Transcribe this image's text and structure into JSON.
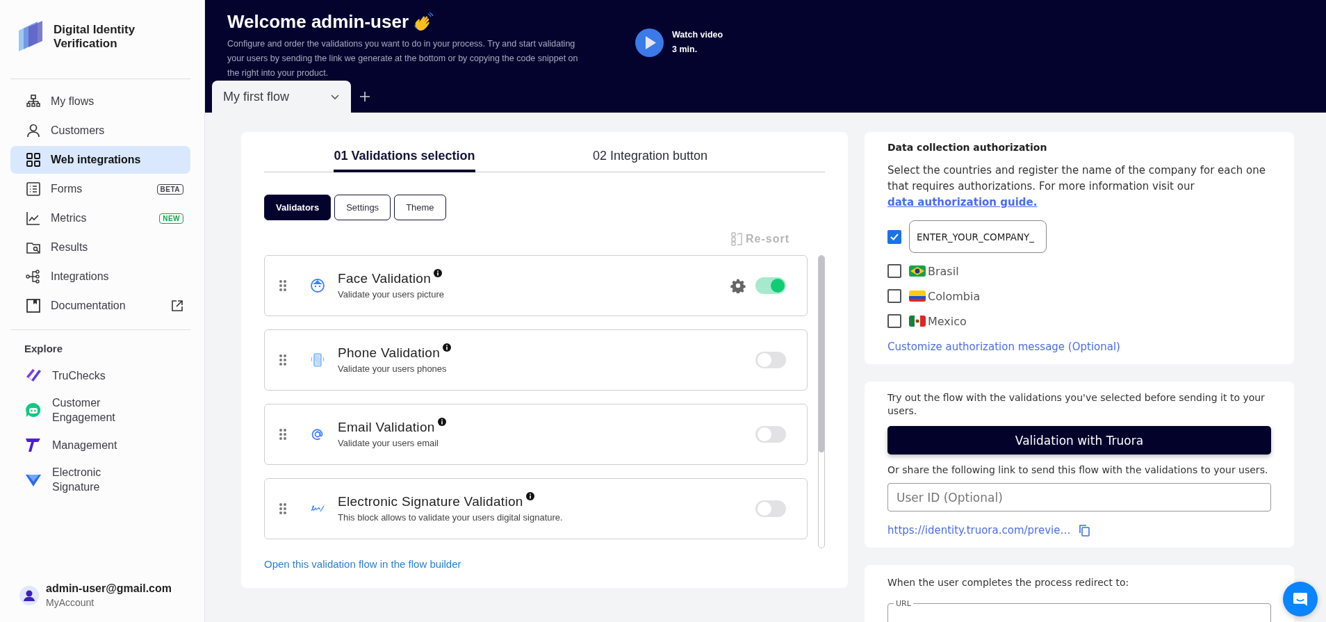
{
  "sidebar": {
    "product_title": "Digital Identity Verification",
    "nav_items": [
      {
        "label": "My flows",
        "selected": false
      },
      {
        "label": "Customers",
        "selected": false
      },
      {
        "label": "Web integrations",
        "selected": true
      },
      {
        "label": "Forms",
        "selected": false,
        "badge": {
          "text": "BETA",
          "color": "#3f3f46"
        }
      },
      {
        "label": "Metrics",
        "selected": false,
        "badge": {
          "text": "NEW",
          "color": "#16a34a"
        }
      },
      {
        "label": "Results",
        "selected": false
      },
      {
        "label": "Integrations",
        "selected": false
      },
      {
        "label": "Documentation",
        "selected": false,
        "external": true
      }
    ],
    "explore_heading": "Explore",
    "explore_items": [
      {
        "label": "TruChecks"
      },
      {
        "label": "Customer Engagement"
      },
      {
        "label": "Management"
      },
      {
        "label": "Electronic Signature"
      }
    ],
    "account": {
      "email": "admin-user@gmail.com",
      "link": "MyAccount"
    }
  },
  "header": {
    "title": "Welcome admin-user",
    "description": "Configure and order the validations you want to do in your process. Try and start validating your users by sending the link we generate at the bottom or by copying the code snippet on the right into your product.",
    "video": {
      "title": "Watch video",
      "duration": "3 min."
    },
    "flow_tabs": [
      {
        "label": "My first flow",
        "selected": true
      }
    ]
  },
  "builder": {
    "steps": [
      {
        "label": "01 Validations selection",
        "selected": true
      },
      {
        "label": "02 Integration button",
        "selected": false
      }
    ],
    "subtabs": [
      {
        "label": "Validators",
        "selected": true
      },
      {
        "label": "Settings",
        "selected": false
      },
      {
        "label": "Theme",
        "selected": false
      }
    ],
    "resort": "Re-sort",
    "validations": [
      {
        "title": "Face Validation",
        "description": "Validate your users picture",
        "enabled": true,
        "configurable": true
      },
      {
        "title": "Phone Validation",
        "description": "Validate your users phones",
        "enabled": false,
        "configurable": false
      },
      {
        "title": "Email Validation",
        "description": "Validate your users email",
        "enabled": false,
        "configurable": false
      },
      {
        "title": "Electronic Signature Validation",
        "description": "This block allows to validate your users digital signature.",
        "enabled": false,
        "configurable": false
      }
    ],
    "flow_builder_link": "Open this validation flow in the flow builder"
  },
  "authorization": {
    "title": "Data collection authorization",
    "text": "Select the countries and register the name of the company for each one that requires authorizations. For more information visit our",
    "link": "data authorization guide.",
    "company": {
      "checked": true,
      "value": "ENTER_YOUR_COMPANY_"
    },
    "countries": [
      {
        "name": "Brasil",
        "checked": false
      },
      {
        "name": "Colombia",
        "checked": false
      },
      {
        "name": "Mexico",
        "checked": false
      }
    ],
    "customize_link": "Customize authorization message (Optional)"
  },
  "preview": {
    "text": "Try out the flow with the validations you've selected before sending it to your users.",
    "button": "Validation with Truora",
    "share_text": "Or share the following link to send this flow with the validations to your users.",
    "user_id_placeholder": "User ID (Optional)",
    "url": "https://identity.truora.com/previe…"
  },
  "redirect": {
    "text": "When the user completes the process redirect to:",
    "url_label": "URL"
  }
}
